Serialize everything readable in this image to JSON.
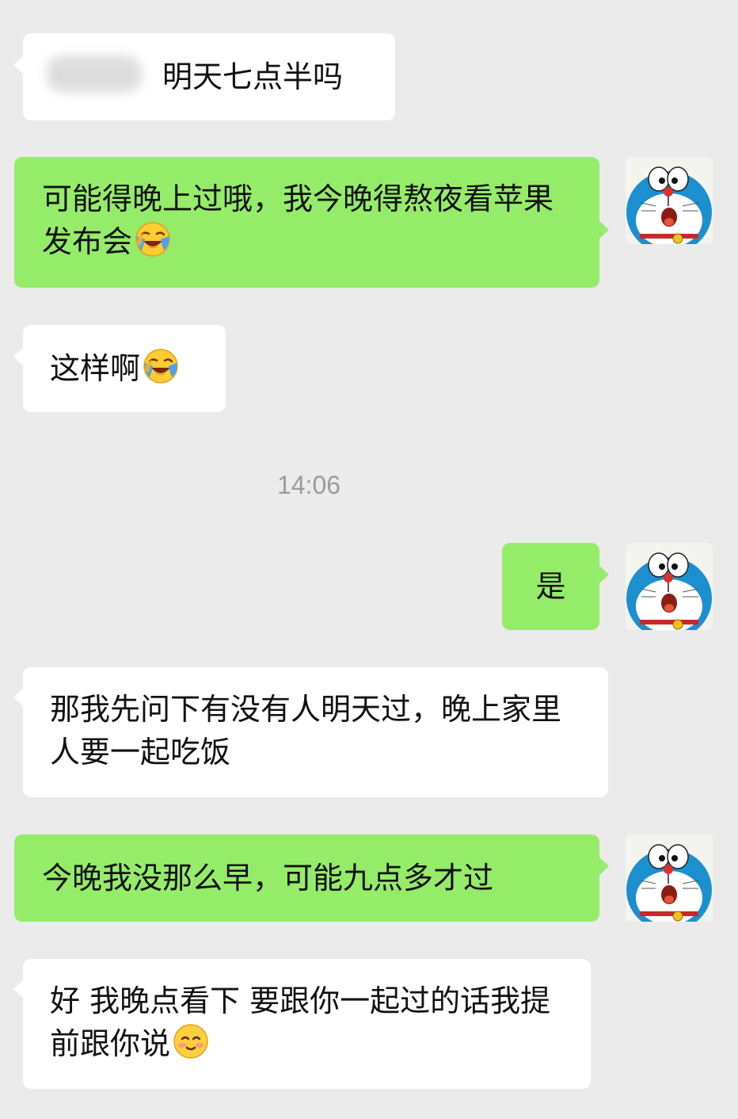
{
  "chat": {
    "timestamp": "14:06",
    "messages": [
      {
        "from": "them",
        "text": "明天七点半吗"
      },
      {
        "from": "me",
        "text": "可能得晚上过哦，我今晚得熬夜看苹果发布会",
        "emoji": "laughing-crying-emoji"
      },
      {
        "from": "them",
        "text": "这样啊",
        "emoji": "laughing-crying-emoji"
      },
      {
        "from": "me",
        "text": "是"
      },
      {
        "from": "them",
        "text": "那我先问下有没有人明天过，晚上家里人要一起吃饭"
      },
      {
        "from": "me",
        "text": "今晚我没那么早，可能九点多才过"
      },
      {
        "from": "them",
        "text": "好 我晚点看下 要跟你一起过的话我提前跟你说",
        "emoji": "blushing-smile-emoji"
      }
    ]
  },
  "colors": {
    "background": "#ebebeb",
    "incoming_bubble": "#ffffff",
    "outgoing_bubble": "#95ec69",
    "timestamp_text": "#9b9b9b"
  },
  "icons": {
    "avatar": "doraemon-avatar-icon"
  }
}
